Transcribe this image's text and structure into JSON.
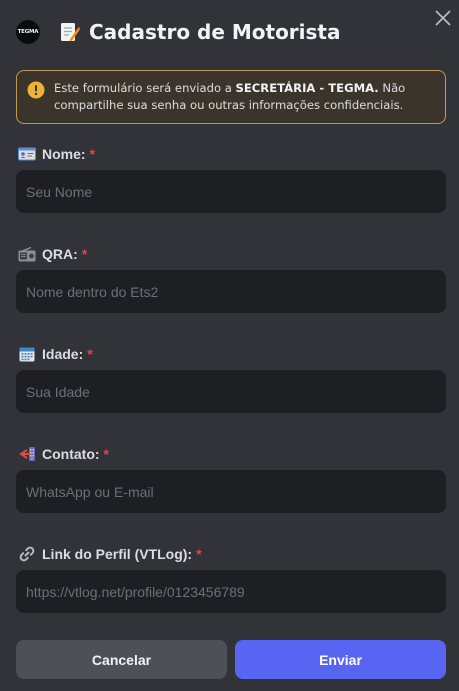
{
  "modal": {
    "logo_text": "TEGMA",
    "title": "Cadastro de Motorista",
    "close_icon": "close-icon",
    "title_icon": "memo-icon"
  },
  "notice": {
    "icon": "warning-icon",
    "text_before": "Este formulário será enviado a ",
    "text_strong": "SECRETÁRIA - TEGMA.",
    "text_after": " Não compartilhe sua senha ou outras informações confidenciais.",
    "border_color": "#c29a54"
  },
  "fields": [
    {
      "icon": "id-card-icon",
      "label": "Nome:",
      "required": "*",
      "placeholder": "Seu Nome",
      "value": ""
    },
    {
      "icon": "radio-icon",
      "label": "QRA:",
      "required": "*",
      "placeholder": "Nome dentro do Ets2",
      "value": ""
    },
    {
      "icon": "calendar-icon",
      "label": "Idade:",
      "required": "*",
      "placeholder": "Sua Idade",
      "value": ""
    },
    {
      "icon": "contact-icon",
      "label": "Contato:",
      "required": "*",
      "placeholder": "WhatsApp ou E-mail",
      "value": ""
    },
    {
      "icon": "link-icon",
      "label": "Link do Perfil (VTLog):",
      "required": "*",
      "placeholder": "https://vtlog.net/profile/0123456789",
      "value": ""
    }
  ],
  "buttons": {
    "cancel": "Cancelar",
    "submit": "Enviar"
  },
  "colors": {
    "background": "#313338",
    "input_background": "#1e1f22",
    "primary": "#5865f2",
    "required": "#f23f43"
  }
}
